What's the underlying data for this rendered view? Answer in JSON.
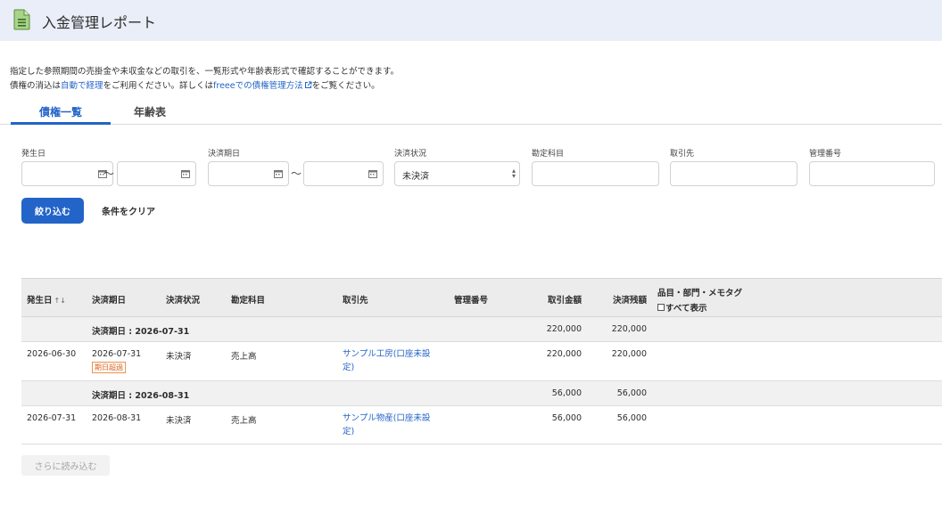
{
  "header": {
    "title": "入金管理レポート"
  },
  "description": {
    "line1": "指定した参照期間の売掛金や未収金などの取引を、一覧形式や年齢表形式で確認することができます。",
    "line2_prefix": "債権の消込は",
    "line2_link1": "自動で経理",
    "line2_mid": "をご利用ください。詳しくは",
    "line2_link2": "freeeでの債権管理方法",
    "line2_suffix": "をご覧ください。"
  },
  "tabs": [
    {
      "label": "債権一覧",
      "active": true
    },
    {
      "label": "年齢表",
      "active": false
    }
  ],
  "filters": {
    "issue_date_label": "発生日",
    "due_date_label": "決済期日",
    "status_label": "決済状況",
    "status_value": "未決済",
    "account_label": "勘定科目",
    "partner_label": "取引先",
    "ref_no_label": "管理番号",
    "range_separator": "〜"
  },
  "actions": {
    "filter_button": "絞り込む",
    "clear_button": "条件をクリア",
    "load_more": "さらに読み込む"
  },
  "table": {
    "columns": {
      "issue_date": "発生日",
      "due_date": "決済期日",
      "status": "決済状況",
      "account": "勘定科目",
      "partner": "取引先",
      "ref_no": "管理番号",
      "amount": "取引金額",
      "balance": "決済残額",
      "tags": "品目・部門・メモタグ",
      "show_all": "すべて表示"
    },
    "sort_indicator": "↑↓",
    "groups": [
      {
        "label": "決済期日 : 2026-07-31",
        "amount": "220,000",
        "balance": "220,000"
      },
      {
        "label": "決済期日 : 2026-08-31",
        "amount": "56,000",
        "balance": "56,000"
      }
    ],
    "rows": [
      {
        "issue_date": "2026-06-30",
        "due_date": "2026-07-31",
        "badge": "期日超過",
        "status": "未決済",
        "account": "売上高",
        "partner": "サンプル工房(口座未設定)",
        "amount": "220,000",
        "balance": "220,000"
      },
      {
        "issue_date": "2026-07-31",
        "due_date": "2026-08-31",
        "badge": "",
        "status": "未決済",
        "account": "売上高",
        "partner": "サンプル物産(口座未設定)",
        "amount": "56,000",
        "balance": "56,000"
      }
    ]
  },
  "colors": {
    "accent": "#2364c8",
    "header_bg": "#e9eef8",
    "badge": "#d9611c"
  },
  "icons": [
    "document-icon",
    "calendar-icon",
    "external-link-icon",
    "sort-icon",
    "select-arrow-icon"
  ]
}
